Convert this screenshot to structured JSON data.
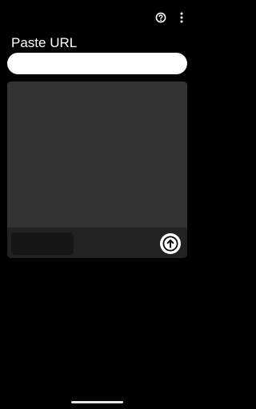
{
  "header": {
    "help_icon": "help-circle-icon",
    "menu_icon": "more-vert-icon"
  },
  "paste": {
    "label": "Paste URL",
    "value": "",
    "placeholder": ""
  },
  "card": {
    "upload_icon": "arrow-up-circle-icon"
  },
  "colors": {
    "background": "#000000",
    "input": "#ffffff",
    "card": "#333333",
    "card_bar": "#222222"
  }
}
